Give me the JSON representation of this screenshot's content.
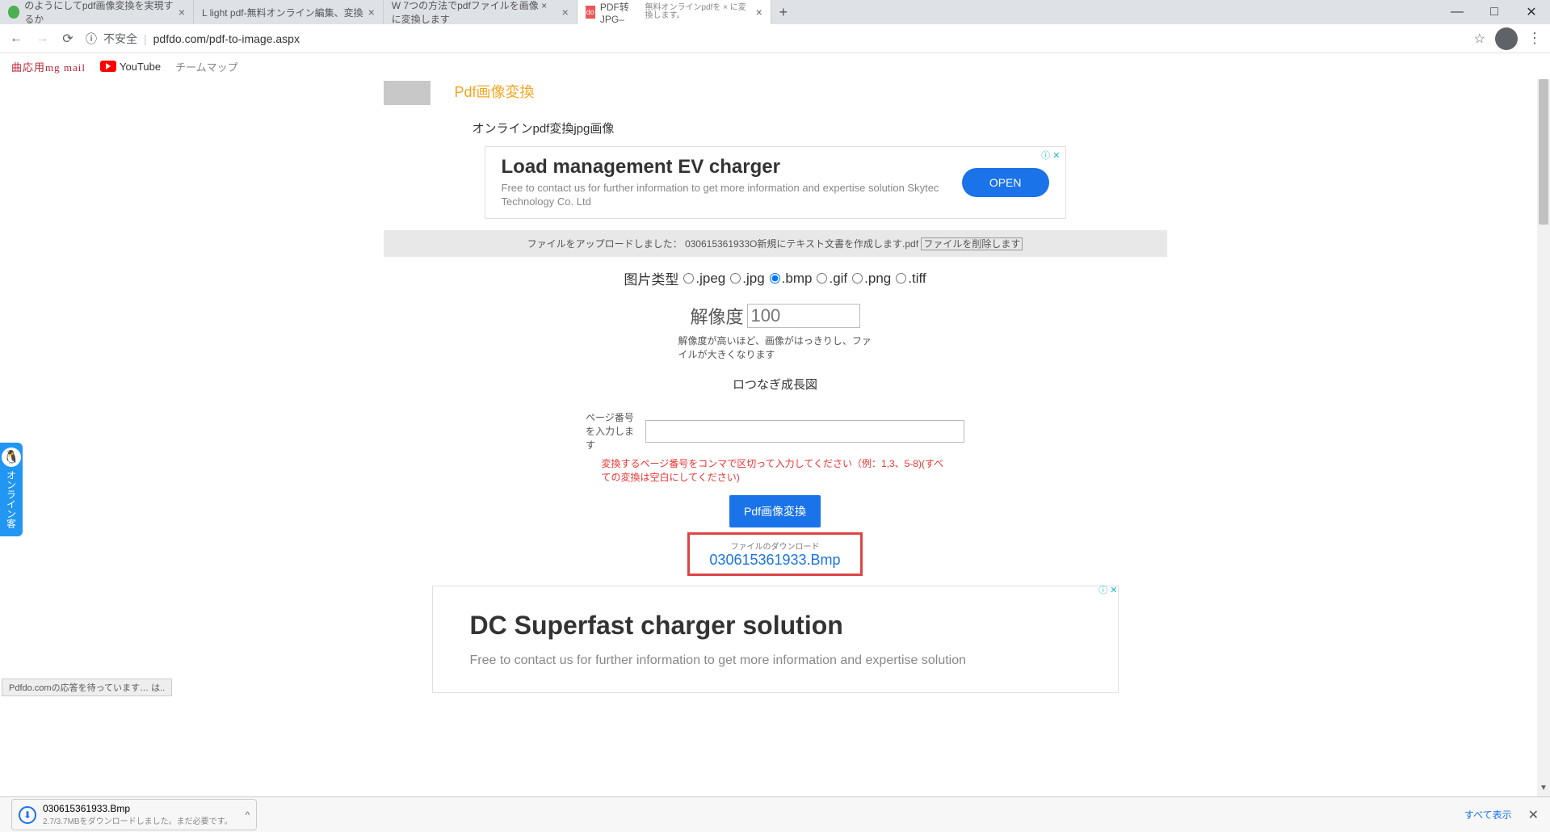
{
  "tabs": [
    {
      "title": "のようにしてpdf画像変換を実現するか",
      "active": false
    },
    {
      "title": "L light pdf-無料オンライン編集、変換",
      "active": false
    },
    {
      "title": "W 7つの方法でpdfファイルを画像 × に変換します",
      "active": false
    },
    {
      "title": "PDF转JPG–",
      "subtitle": "無料オンラインpdfを × に変換します。",
      "active": true
    }
  ],
  "url": {
    "insecure": "不安全",
    "text": "pdfdo.com/pdf-to-image.aspx",
    "info_icon": "ⓘ"
  },
  "bookmarks": {
    "b1": "曲応用mg mail",
    "b2": "YouTube",
    "b3": "チームマップ"
  },
  "page": {
    "title": "Pdf画像変換",
    "subtitle": "オンラインpdf変換jpg画像"
  },
  "ad1": {
    "headline": "Load management EV charger",
    "body": "Free to contact us for further information to get more information and expertise solution Skytec Technology Co. Ltd",
    "cta": "OPEN",
    "close": "ⓘ ✕"
  },
  "upload": {
    "prefix": "ファイルをアップロードしました：",
    "file": "030615361933O新規にテキスト文書を作成します.pdf",
    "del": "ファイルを削除します"
  },
  "radios": {
    "label": "图片类型",
    "opts": [
      ".jpeg",
      ".jpg",
      ".bmp",
      ".gif",
      ".png",
      ".tiff"
    ],
    "selected": 2
  },
  "resolution": {
    "label": "解像度",
    "value": "100",
    "hint": "解像度が高いほど、画像がはっきりし、ファイルが大きくなります"
  },
  "chain": "ロつなぎ成長図",
  "pages": {
    "label": "ページ番号を入力します",
    "hint": "変換するページ番号をコンマで区切って入力してください（例：1,3、5-8)(すべての変換は空白にしてください)"
  },
  "convert_btn": "Pdf画像変換",
  "download": {
    "t": "ファイルのダウンロード",
    "f": "030615361933.Bmp"
  },
  "ad2": {
    "headline": "DC Superfast charger solution",
    "body": "Free to contact us for further information to get more information and expertise solution",
    "close": "ⓘ ✕"
  },
  "sidewidget": {
    "qq": "🐧",
    "text": "オンライン客"
  },
  "status": "Pdfdo.comの応答を待っています… は..",
  "dlshelf": {
    "file": "030615361933.Bmp",
    "sub": "2.7/3.7MBをダウンロードしました。まだ必要です。",
    "showall": "すべて表示"
  }
}
